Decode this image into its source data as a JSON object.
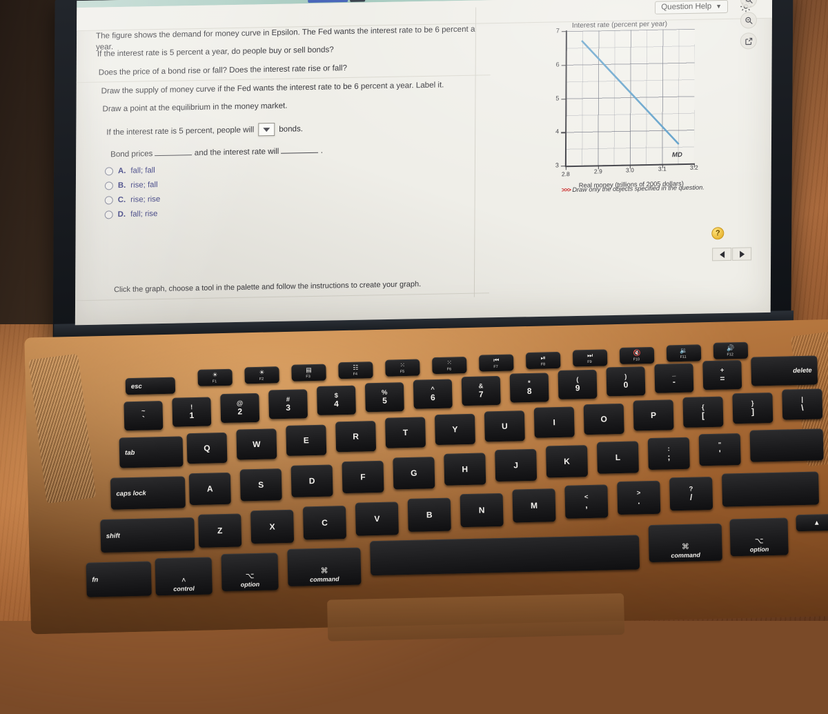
{
  "app": {
    "header": {
      "question_help_label": "Question Help",
      "question_help_caret": "▼",
      "gear_icon": "gear-icon"
    },
    "help_badge": "?",
    "nav": {
      "prev": "◀",
      "next": "▶"
    }
  },
  "question": {
    "paragraphs": [
      "The figure shows the demand for money curve in Epsilon. The Fed wants the interest rate to be 6 percent a year.",
      "If the interest rate is 5 percent a year, do people buy or sell bonds?",
      "Does the price of a bond rise or fall? Does the interest rate rise or fall?",
      "Draw the supply of money curve if the Fed wants the interest rate to be 6 percent a year. Label it.",
      "Draw a point at the equilibrium in the money market."
    ],
    "dropdown_sentence_before": "If the interest rate is 5 percent, people will",
    "dropdown_value": "",
    "dropdown_caret": "▼",
    "dropdown_sentence_after": "bonds.",
    "fill_sentence_before": "Bond prices",
    "fill_sentence_middle": "and the interest rate will",
    "fill_sentence_after": ".",
    "choices": [
      {
        "letter": "A.",
        "text": "fall; fall"
      },
      {
        "letter": "B.",
        "text": "rise; fall"
      },
      {
        "letter": "C.",
        "text": "rise; rise"
      },
      {
        "letter": "D.",
        "text": "fall; rise"
      }
    ],
    "bottom_note": "Click the graph, choose a tool in the palette and follow the instructions to create your graph."
  },
  "graph_tools": [
    {
      "name": "zoom-in-icon",
      "label": "Zoom in"
    },
    {
      "name": "zoom-out-icon",
      "label": "Zoom out"
    },
    {
      "name": "expand-icon",
      "label": "Open in new window"
    }
  ],
  "chart_data": {
    "type": "line",
    "title": "Interest rate (percent  per year)",
    "xlabel": "Real money (trillions of 2005 dollars)",
    "ylabel": "Interest rate (percent  per year)",
    "xlim": [
      2.8,
      3.2
    ],
    "ylim": [
      3,
      7
    ],
    "xticks": [
      "2.8",
      "2.9",
      "3.0",
      "3.1",
      "3.2"
    ],
    "xtick_values": [
      2.8,
      2.9,
      3.0,
      3.1,
      3.2
    ],
    "yticks": [
      "3",
      "4",
      "5",
      "6",
      "7"
    ],
    "ytick_values": [
      3,
      4,
      5,
      6,
      7
    ],
    "grid": true,
    "grid_minor_x": 0.05,
    "grid_minor_y": 0.5,
    "legend": "none",
    "series": [
      {
        "name": "MD",
        "label": "MD",
        "color": "#5b9dc8",
        "x": [
          2.85,
          3.15
        ],
        "y": [
          6.7,
          3.6
        ],
        "annotation": "MD"
      }
    ],
    "note": ">>> Draw only the objects specified in the question.",
    "note_arrows": ">>>",
    "note_text": "Draw only the objects specified in the question.",
    "note_color": "#cc2a2a"
  },
  "keyboard": {
    "function_row": [
      {
        "name": "esc",
        "label": "esc",
        "type": "word"
      },
      {
        "name": "f1",
        "glyph": "☀",
        "fl": "F1"
      },
      {
        "name": "f2",
        "glyph": "☀",
        "fl": "F2"
      },
      {
        "name": "f3",
        "glyph": "▤",
        "fl": "F3"
      },
      {
        "name": "f4",
        "glyph": "☷",
        "fl": "F4"
      },
      {
        "name": "f5",
        "glyph": "⁙",
        "fl": "F5"
      },
      {
        "name": "f6",
        "glyph": "⁙",
        "fl": "F6"
      },
      {
        "name": "f7",
        "glyph": "⏮",
        "fl": "F7"
      },
      {
        "name": "f8",
        "glyph": "⏯",
        "fl": "F8"
      },
      {
        "name": "f9",
        "glyph": "⏭",
        "fl": "F9"
      },
      {
        "name": "f10",
        "glyph": "🔇",
        "fl": "F10"
      },
      {
        "name": "f11",
        "glyph": "🔉",
        "fl": "F11"
      },
      {
        "name": "f12",
        "glyph": "🔊",
        "fl": "F12"
      }
    ],
    "number_row": [
      {
        "name": "tilde",
        "up": "~",
        "lo": "`"
      },
      {
        "name": "1",
        "up": "!",
        "lo": "1"
      },
      {
        "name": "2",
        "up": "@",
        "lo": "2"
      },
      {
        "name": "3",
        "up": "#",
        "lo": "3"
      },
      {
        "name": "4",
        "up": "$",
        "lo": "4"
      },
      {
        "name": "5",
        "up": "%",
        "lo": "5"
      },
      {
        "name": "6",
        "up": "^",
        "lo": "6"
      },
      {
        "name": "7",
        "up": "&",
        "lo": "7"
      },
      {
        "name": "8",
        "up": "*",
        "lo": "8"
      },
      {
        "name": "9",
        "up": "(",
        "lo": "9"
      },
      {
        "name": "0",
        "up": ")",
        "lo": "0"
      },
      {
        "name": "minus",
        "up": "_",
        "lo": "-"
      },
      {
        "name": "equals",
        "up": "+",
        "lo": "="
      },
      {
        "name": "delete",
        "label": "delete",
        "type": "word"
      }
    ],
    "q_row": [
      {
        "name": "tab",
        "label": "tab",
        "type": "word"
      },
      {
        "name": "q",
        "lo": "Q"
      },
      {
        "name": "w",
        "lo": "W"
      },
      {
        "name": "e",
        "lo": "E"
      },
      {
        "name": "r",
        "lo": "R"
      },
      {
        "name": "t",
        "lo": "T"
      },
      {
        "name": "y",
        "lo": "Y"
      },
      {
        "name": "u",
        "lo": "U"
      },
      {
        "name": "i",
        "lo": "I"
      },
      {
        "name": "o",
        "lo": "O"
      },
      {
        "name": "p",
        "lo": "P"
      },
      {
        "name": "bracket-left",
        "up": "{",
        "lo": "["
      },
      {
        "name": "bracket-right",
        "up": "}",
        "lo": "]"
      },
      {
        "name": "backslash",
        "up": "|",
        "lo": "\\"
      }
    ],
    "a_row": [
      {
        "name": "caps-lock",
        "label": "caps lock",
        "type": "word"
      },
      {
        "name": "a",
        "lo": "A"
      },
      {
        "name": "s",
        "lo": "S"
      },
      {
        "name": "d",
        "lo": "D"
      },
      {
        "name": "f",
        "lo": "F"
      },
      {
        "name": "g",
        "lo": "G"
      },
      {
        "name": "h",
        "lo": "H"
      },
      {
        "name": "j",
        "lo": "J"
      },
      {
        "name": "k",
        "lo": "K"
      },
      {
        "name": "l",
        "lo": "L"
      },
      {
        "name": "semicolon",
        "up": ":",
        "lo": ";"
      },
      {
        "name": "quote",
        "up": "\"",
        "lo": "'"
      }
    ],
    "z_row": [
      {
        "name": "shift-left",
        "label": "shift",
        "type": "word"
      },
      {
        "name": "z",
        "lo": "Z"
      },
      {
        "name": "x",
        "lo": "X"
      },
      {
        "name": "c",
        "lo": "C"
      },
      {
        "name": "v",
        "lo": "V"
      },
      {
        "name": "b",
        "lo": "B"
      },
      {
        "name": "n",
        "lo": "N"
      },
      {
        "name": "m",
        "lo": "M"
      },
      {
        "name": "comma",
        "up": "<",
        "lo": ","
      },
      {
        "name": "period",
        "up": ">",
        "lo": "."
      },
      {
        "name": "slash",
        "up": "?",
        "lo": "/"
      }
    ],
    "bottom_row": [
      {
        "name": "fn",
        "label": "fn"
      },
      {
        "name": "control",
        "sym": "˄",
        "nm": "control"
      },
      {
        "name": "option-left",
        "sym": "⌥",
        "nm": "option"
      },
      {
        "name": "command-left",
        "sym": "⌘",
        "nm": "command"
      },
      {
        "name": "space",
        "label": ""
      },
      {
        "name": "command-right",
        "sym": "⌘",
        "nm": "command"
      },
      {
        "name": "option-right",
        "sym": "⌥",
        "nm": "option"
      },
      {
        "name": "arrow-up",
        "sym": "▴",
        "nm": ""
      }
    ]
  }
}
